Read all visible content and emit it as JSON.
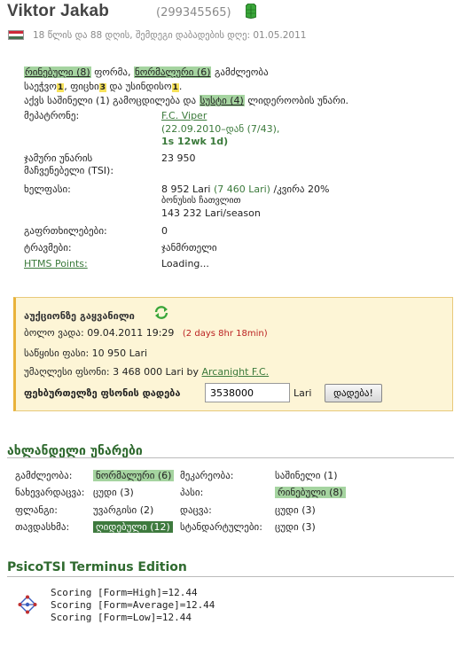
{
  "header": {
    "player_name": "Viktor Jakab",
    "player_id": "(299345565)",
    "subtitle": "18 წლის და 88 დღის, შემდეგი დაბადების დღე: 01.05.2011",
    "colors": {
      "flag_red": "#ce2939",
      "flag_white": "#ffffff",
      "flag_green": "#477050",
      "shirt": "#3aa63a"
    }
  },
  "summary": {
    "form_value": "რინებული (8)",
    "form_word": "ფორმა,",
    "exp_value": "ნორმალური (6)",
    "exp_word": "გამძლეობა",
    "agg_word": "საეჭვო",
    "agg_num": "1",
    "hon_word": "ფიცხი",
    "hon_num": "3",
    "and1": "და",
    "honesty_word": "უსინდისო",
    "honesty_num": "1",
    "lead_prefix": "აქვს საშინელი (1) გამოცდილება და",
    "lead_value": "სუსტი (4)",
    "lead_suffix": "ლიდეროობის უნარი."
  },
  "info": {
    "trainer_label": "მეპატრონე:",
    "trainer_link": "F.C. Viper",
    "trainer_since": "(22.09.2010–დან (7/43),",
    "trainer_since_num": "1s 12wk 1d)",
    "tsi_label_1": "ჯამური უნარის",
    "tsi_label_2": "მაჩვენებელი (TSI):",
    "tsi_value": "23 950",
    "salary_label": "ხელფასი:",
    "salary_value": "8 952 Lari",
    "salary_original": "(7 460 Lari)",
    "salary_suffix": "/კვირა 20%",
    "salary_bonus": "ბონუსის ჩათვლით",
    "salary_season": "143 232 Lari/season",
    "warnings_label": "გაფრთხილებები:",
    "warnings_value": "0",
    "injuries_label": "ტრავმები:",
    "injuries_value": "ჯანმრთელი",
    "htms_label": "HTMS Points:",
    "htms_value": "Loading..."
  },
  "auction": {
    "title": "აუქციონზე გაყვანილი",
    "deadline_label": "ბოლო ვადა:",
    "deadline_value": "09.04.2011 19:29",
    "deadline_remaining": "(2 days 8hr 18min)",
    "start_label": "საწყისი ფასი:",
    "start_value": "10 950 Lari",
    "highest_label": "უმაღლესი ფსონი:",
    "highest_value": "3 468 000 Lari by",
    "highest_by": "Arcanight F.C.",
    "bid_label": "ფეხბურთელზე ფსონის დადება",
    "bid_input": "3538000",
    "bid_currency": "Lari",
    "bid_button": "დადება!"
  },
  "skills": {
    "title": "ახლანდელი უნარები",
    "rows": [
      {
        "l1": "გამძლეობა:",
        "v1": "ნორმალური (6)",
        "l2": "მეკარეობა:",
        "v2": "საშინელი (1)"
      },
      {
        "l1": "ნახევარდაცვა:",
        "v1": "ცუდი (3)",
        "l2": "პასი:",
        "v2": "რინებული (8)"
      },
      {
        "l1": "ფლანგი:",
        "v1": "უვარგისი (2)",
        "l2": "დაცვა:",
        "v2": "ცუდი (3)"
      },
      {
        "l1": "თავდასხმა:",
        "v1": "ღიდებული (12)",
        "l2": "სტანდარტულები:",
        "v2": "ცუდი (3)"
      }
    ]
  },
  "psico": {
    "title": "PsicoTSI Terminus Edition",
    "lines": [
      "Scoring [Form=High]=12.44",
      "Scoring [Form=Average]=12.44",
      "Scoring [Form=Low]=12.44"
    ]
  }
}
